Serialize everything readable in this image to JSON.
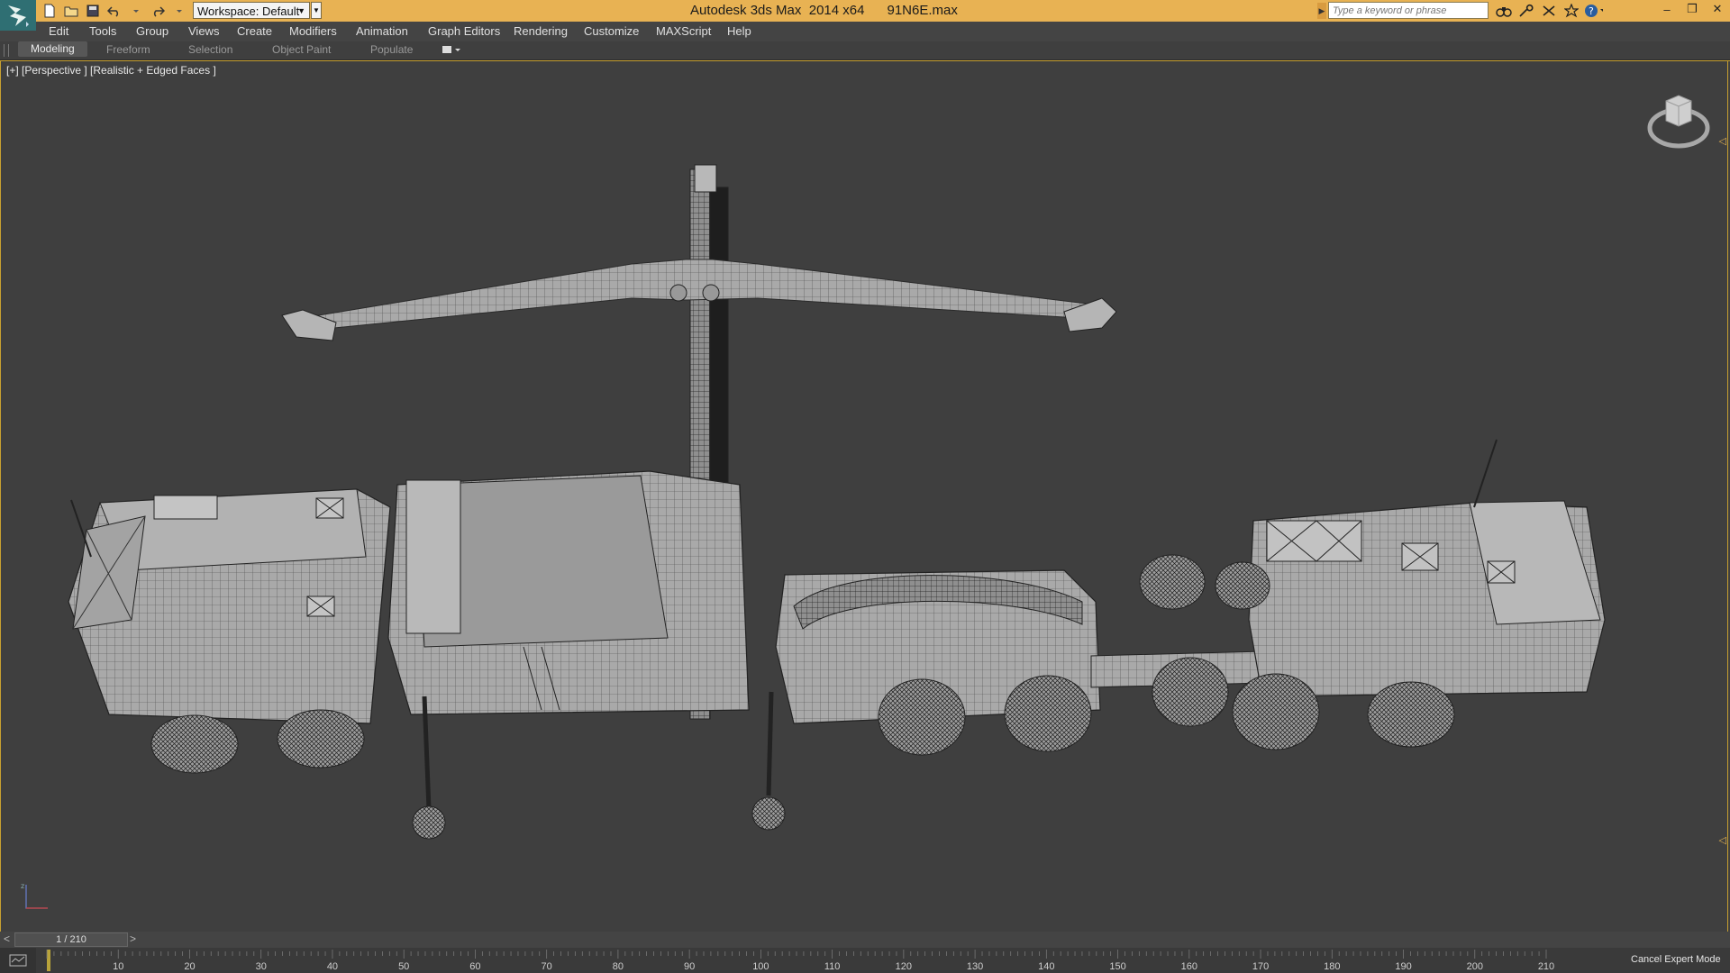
{
  "titlebar": {
    "app_title": "Autodesk 3ds Max  2014 x64",
    "file_name": "91N6E.max",
    "workspace_label": "Workspace: Default",
    "search_placeholder": "Type a keyword or phrase"
  },
  "quick_access": [
    "new-icon",
    "open-icon",
    "save-icon",
    "undo-icon",
    "redo-icon",
    "project-folder-icon"
  ],
  "menu": [
    "Edit",
    "Tools",
    "Group",
    "Views",
    "Create",
    "Modifiers",
    "Animation",
    "Graph Editors",
    "Rendering",
    "Customize",
    "MAXScript",
    "Help"
  ],
  "ribbon_tabs": [
    "Modeling",
    "Freeform",
    "Selection",
    "Object Paint",
    "Populate"
  ],
  "active_ribbon_tab": "Modeling",
  "viewport": {
    "label": "[+] [Perspective ] [Realistic + Edged Faces ]",
    "model_name": "91N6E",
    "border_color": "#c8a030"
  },
  "time_slider": {
    "left_arrow": "<",
    "position_label": "1 / 210",
    "right_arrow": ">",
    "current_frame": 1,
    "total_frames": 210
  },
  "ruler_ticks": [
    "10",
    "20",
    "30",
    "40",
    "50",
    "60",
    "70",
    "80",
    "90",
    "100",
    "110",
    "120",
    "130",
    "140",
    "150",
    "160",
    "170",
    "180",
    "190",
    "200",
    "210"
  ],
  "status": {
    "cancel_expert_mode": "Cancel Expert Mode"
  },
  "colors": {
    "titlebar": "#e8b253",
    "accent": "#c8a030",
    "background": "#3f3f3f"
  }
}
